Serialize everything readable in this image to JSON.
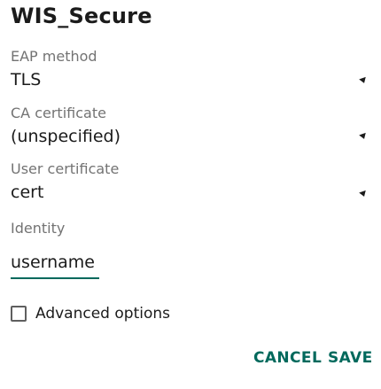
{
  "dialog": {
    "title": "WIS_Secure",
    "eap": {
      "label": "EAP method",
      "value": "TLS"
    },
    "ca_cert": {
      "label": "CA certificate",
      "value": "(unspecified)"
    },
    "user_cert": {
      "label": "User certificate",
      "value": "cert"
    },
    "identity": {
      "label": "Identity",
      "value": "username"
    },
    "advanced": {
      "label": "Advanced options",
      "checked": false
    },
    "buttons": {
      "cancel": "CANCEL",
      "save": "SAVE"
    },
    "colors": {
      "accent": "#00695c",
      "text": "#1b1b1b",
      "secondary_text": "#737373"
    }
  }
}
